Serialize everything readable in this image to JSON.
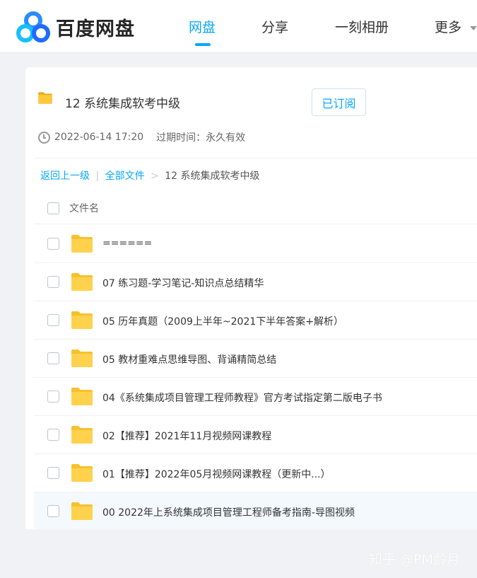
{
  "app": {
    "name": "百度网盘"
  },
  "nav": {
    "items": [
      {
        "label": "网盘",
        "active": true
      },
      {
        "label": "分享",
        "active": false
      },
      {
        "label": "一刻相册",
        "active": false
      },
      {
        "label": "更多",
        "active": false
      }
    ]
  },
  "share": {
    "title": "12 系统集成软考中级",
    "subscribe_label": "已订阅",
    "date": "2022-06-14 17:20",
    "expiry": "过期时间：永久有效"
  },
  "breadcrumb": {
    "back": "返回上一级",
    "sep": "|",
    "all_files": "全部文件",
    "arrow": ">",
    "current": "12 系统集成软考中级"
  },
  "list": {
    "column_header": "文件名",
    "rows": [
      {
        "name": "======"
      },
      {
        "name": "07 练习题-学习笔记-知识点总结精华"
      },
      {
        "name": "05 历年真题（2009上半年~2021下半年答案+解析）"
      },
      {
        "name": "05 教材重难点思维导图、背诵精简总结"
      },
      {
        "name": "04《系统集成项目管理工程师教程》官方考试指定第二版电子书"
      },
      {
        "name": "02【推荐】2021年11月视频网课教程"
      },
      {
        "name": "01【推荐】2022年05月视频网课教程（更新中...）"
      },
      {
        "name": "00 2022年上系统集成项目管理工程师备考指南-导图视频"
      }
    ]
  },
  "watermark": "知乎 @PM龄月",
  "colors": {
    "accent": "#06a7ff",
    "folder": "#ffd24d",
    "hover_row": "#f3f9fd"
  }
}
